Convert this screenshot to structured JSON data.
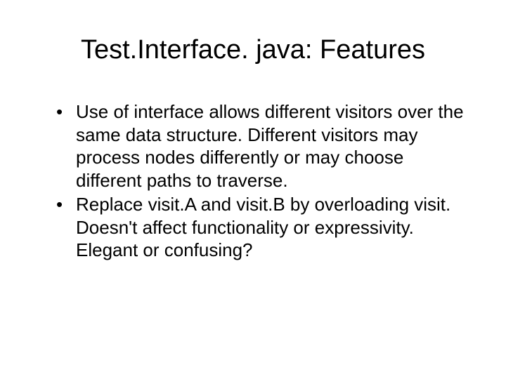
{
  "slide": {
    "title": "Test.Interface. java: Features",
    "bullets": [
      "Use of interface allows different visitors over the same data structure.  Different visitors may process nodes differently or may choose different paths to traverse.",
      "Replace visit.A and visit.B by overloading visit.  Doesn't affect functionality or expressivity. Elegant or confusing?"
    ]
  }
}
